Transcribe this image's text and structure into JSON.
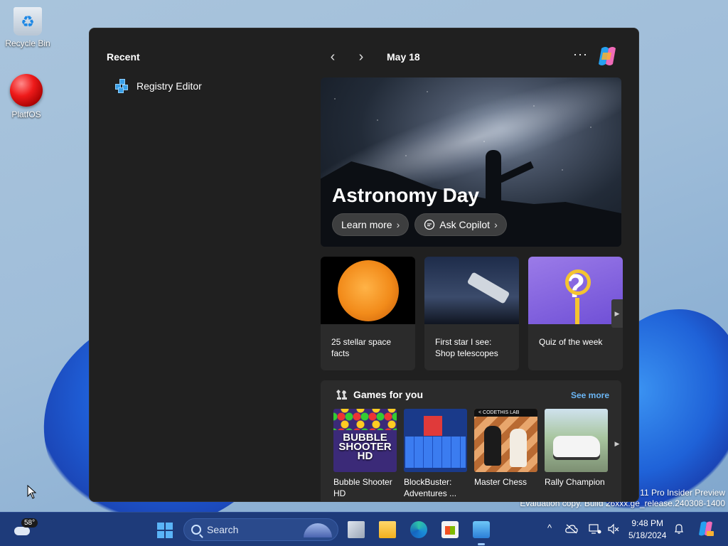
{
  "desktop": {
    "icons": [
      {
        "label": "Recycle Bin"
      },
      {
        "label": "PlatfOS"
      }
    ],
    "watermark": {
      "line1": "11 Pro Insider Preview",
      "line2": "Evaluation copy. Build 26xxx.ge_release.240308-1400"
    }
  },
  "widgets": {
    "recent": {
      "title": "Recent",
      "items": [
        {
          "label": "Registry Editor"
        }
      ]
    },
    "nav": {
      "prev": "‹",
      "next": "›",
      "date": "May 18",
      "more": "···"
    },
    "hero": {
      "title": "Astronomy Day",
      "learn_more": "Learn more",
      "ask_copilot": "Ask Copilot"
    },
    "cards": [
      {
        "caption": "25 stellar space facts"
      },
      {
        "caption": "First star I see: Shop telescopes"
      },
      {
        "caption": "Quiz of the week"
      }
    ],
    "games": {
      "title": "Games for you",
      "see_more": "See more",
      "items": [
        {
          "name": "Bubble Shooter HD",
          "logo": "BUBBLE SHOOTER HD"
        },
        {
          "name": "BlockBuster: Adventures ..."
        },
        {
          "name": "Master Chess",
          "badge": "< CODETHIS LAB"
        },
        {
          "name": "Rally Champion"
        }
      ]
    }
  },
  "taskbar": {
    "weather_temp": "58°",
    "search_placeholder": "Search",
    "time": "9:48 PM",
    "date": "5/18/2024",
    "tray": {
      "chevron": "^"
    }
  },
  "colors": {
    "accent": "#6bb6f5",
    "panel_bg": "#202020",
    "card_bg": "#2b2b2b",
    "taskbar_bg": "#1e3b7a"
  }
}
